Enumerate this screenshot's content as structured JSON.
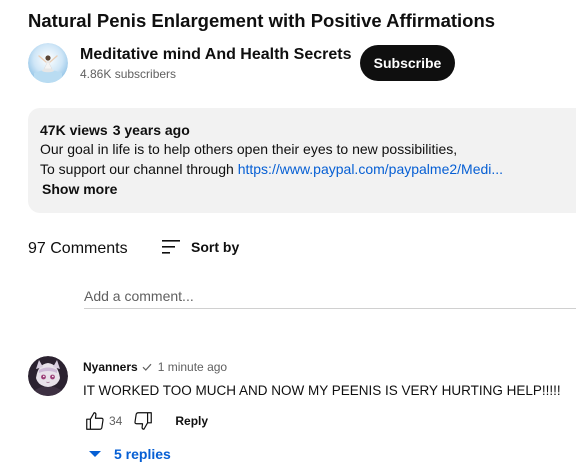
{
  "video": {
    "title": "Natural Penis Enlargement with Positive Affirmations"
  },
  "channel": {
    "name": "Meditative mind And Health Secrets",
    "subscribers": "4.86K subscribers",
    "subscribe_label": "Subscribe"
  },
  "description": {
    "views": "47K views",
    "age": "3 years ago",
    "line1": "Our goal in life is to help others open their eyes to new possibilities,",
    "line2_prefix": "To support our channel through ",
    "link_text": "https://www.paypal.com/paypalme2/Medi...",
    "show_more_label": "Show more"
  },
  "comments": {
    "count_label": "97 Comments",
    "sort_label": "Sort by",
    "add_placeholder": "Add a comment...",
    "items": [
      {
        "author": "Nyanners",
        "time": "1 minute ago",
        "text": "IT WORKED TOO MUCH AND NOW MY PEENIS IS VERY HURTING HELP!!!!!",
        "likes": "34",
        "reply_label": "Reply",
        "replies_label": "5 replies"
      }
    ]
  },
  "colors": {
    "link": "#065fd4",
    "subscribe_bg": "#0f0f0f",
    "description_bg": "#f2f2f2",
    "secondary_text": "#606060"
  }
}
